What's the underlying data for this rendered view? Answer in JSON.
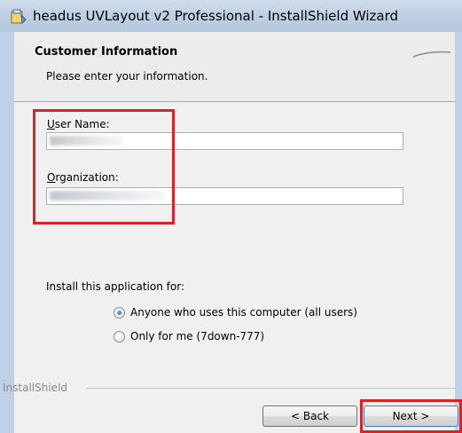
{
  "window": {
    "title": "headus UVLayout v2 Professional - InstallShield Wizard"
  },
  "header": {
    "title": "Customer Information",
    "subtitle": "Please enter your information."
  },
  "form": {
    "user_name_label_mnemonic": "U",
    "user_name_label_rest": "ser Name:",
    "organization_label_mnemonic": "O",
    "organization_label_rest": "rganization:",
    "install_for_label": "Install this application for:",
    "option_all_users": "Anyone who uses this computer (all users)",
    "option_only_me": "Only for me (7down-777)",
    "selected_option": "all_users"
  },
  "footer": {
    "brand": "InstallShield",
    "back_label": "< Back",
    "next_label": "Next >"
  },
  "colors": {
    "highlight": "#d8232a",
    "radio_selected": "#1a5fb4"
  }
}
